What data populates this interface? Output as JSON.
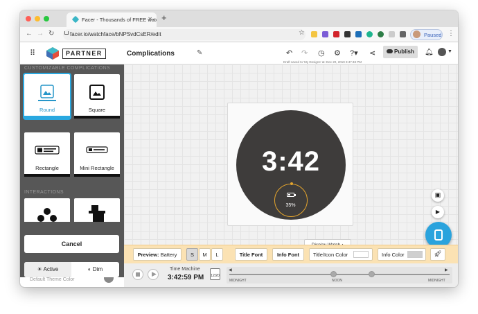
{
  "browser": {
    "tab_title": "Facer - Thousands of FREE watc",
    "url": "facer.io/watchface/bNPSvdCsER/edit",
    "paused_label": "Paused"
  },
  "header": {
    "brand": "PARTNER",
    "title": "Complications",
    "publish_label": "Publish",
    "draft_status": "Draft saved to 'My Designs' at: Dec 20, 2019 3:47:48 PM"
  },
  "sidebar": {
    "section_customizable": "CUSTOMIZABLE COMPLICATIONS",
    "complications": [
      {
        "label": "Round",
        "selected": true
      },
      {
        "label": "Square",
        "selected": false
      },
      {
        "label": "Rectangle",
        "selected": false
      },
      {
        "label": "Mini Rectangle",
        "selected": false
      }
    ],
    "section_interactions": "INTERACTIONS",
    "cancel_label": "Cancel",
    "mode_active": "Active",
    "mode_dim": "Dim",
    "theme_color_label": "Default Theme Color"
  },
  "watch": {
    "time": "3:42",
    "battery_pct": "35%",
    "accent": "#e5a52d",
    "display_watch_label": "Display Watch ▴"
  },
  "toolbar": {
    "preview_prefix": "Preview:",
    "preview_value": "Battery",
    "sizes": [
      "S",
      "M",
      "L"
    ],
    "selected_size": "S",
    "title_font": "Title Font",
    "info_font": "Info Font",
    "title_icon_color": "Title/Icon Color",
    "info_color": "Info Color"
  },
  "footer": {
    "time_machine_label": "Time Machine",
    "time_value": "3:42:59 PM",
    "date": "12/20",
    "timeline_labels": [
      "MIDNIGHT",
      "NOON",
      "MIDNIGHT"
    ]
  },
  "colors": {
    "accent_blue": "#29a8e0",
    "toolbar_bg": "#fbe2b3",
    "sidebar_bg": "#575757"
  }
}
